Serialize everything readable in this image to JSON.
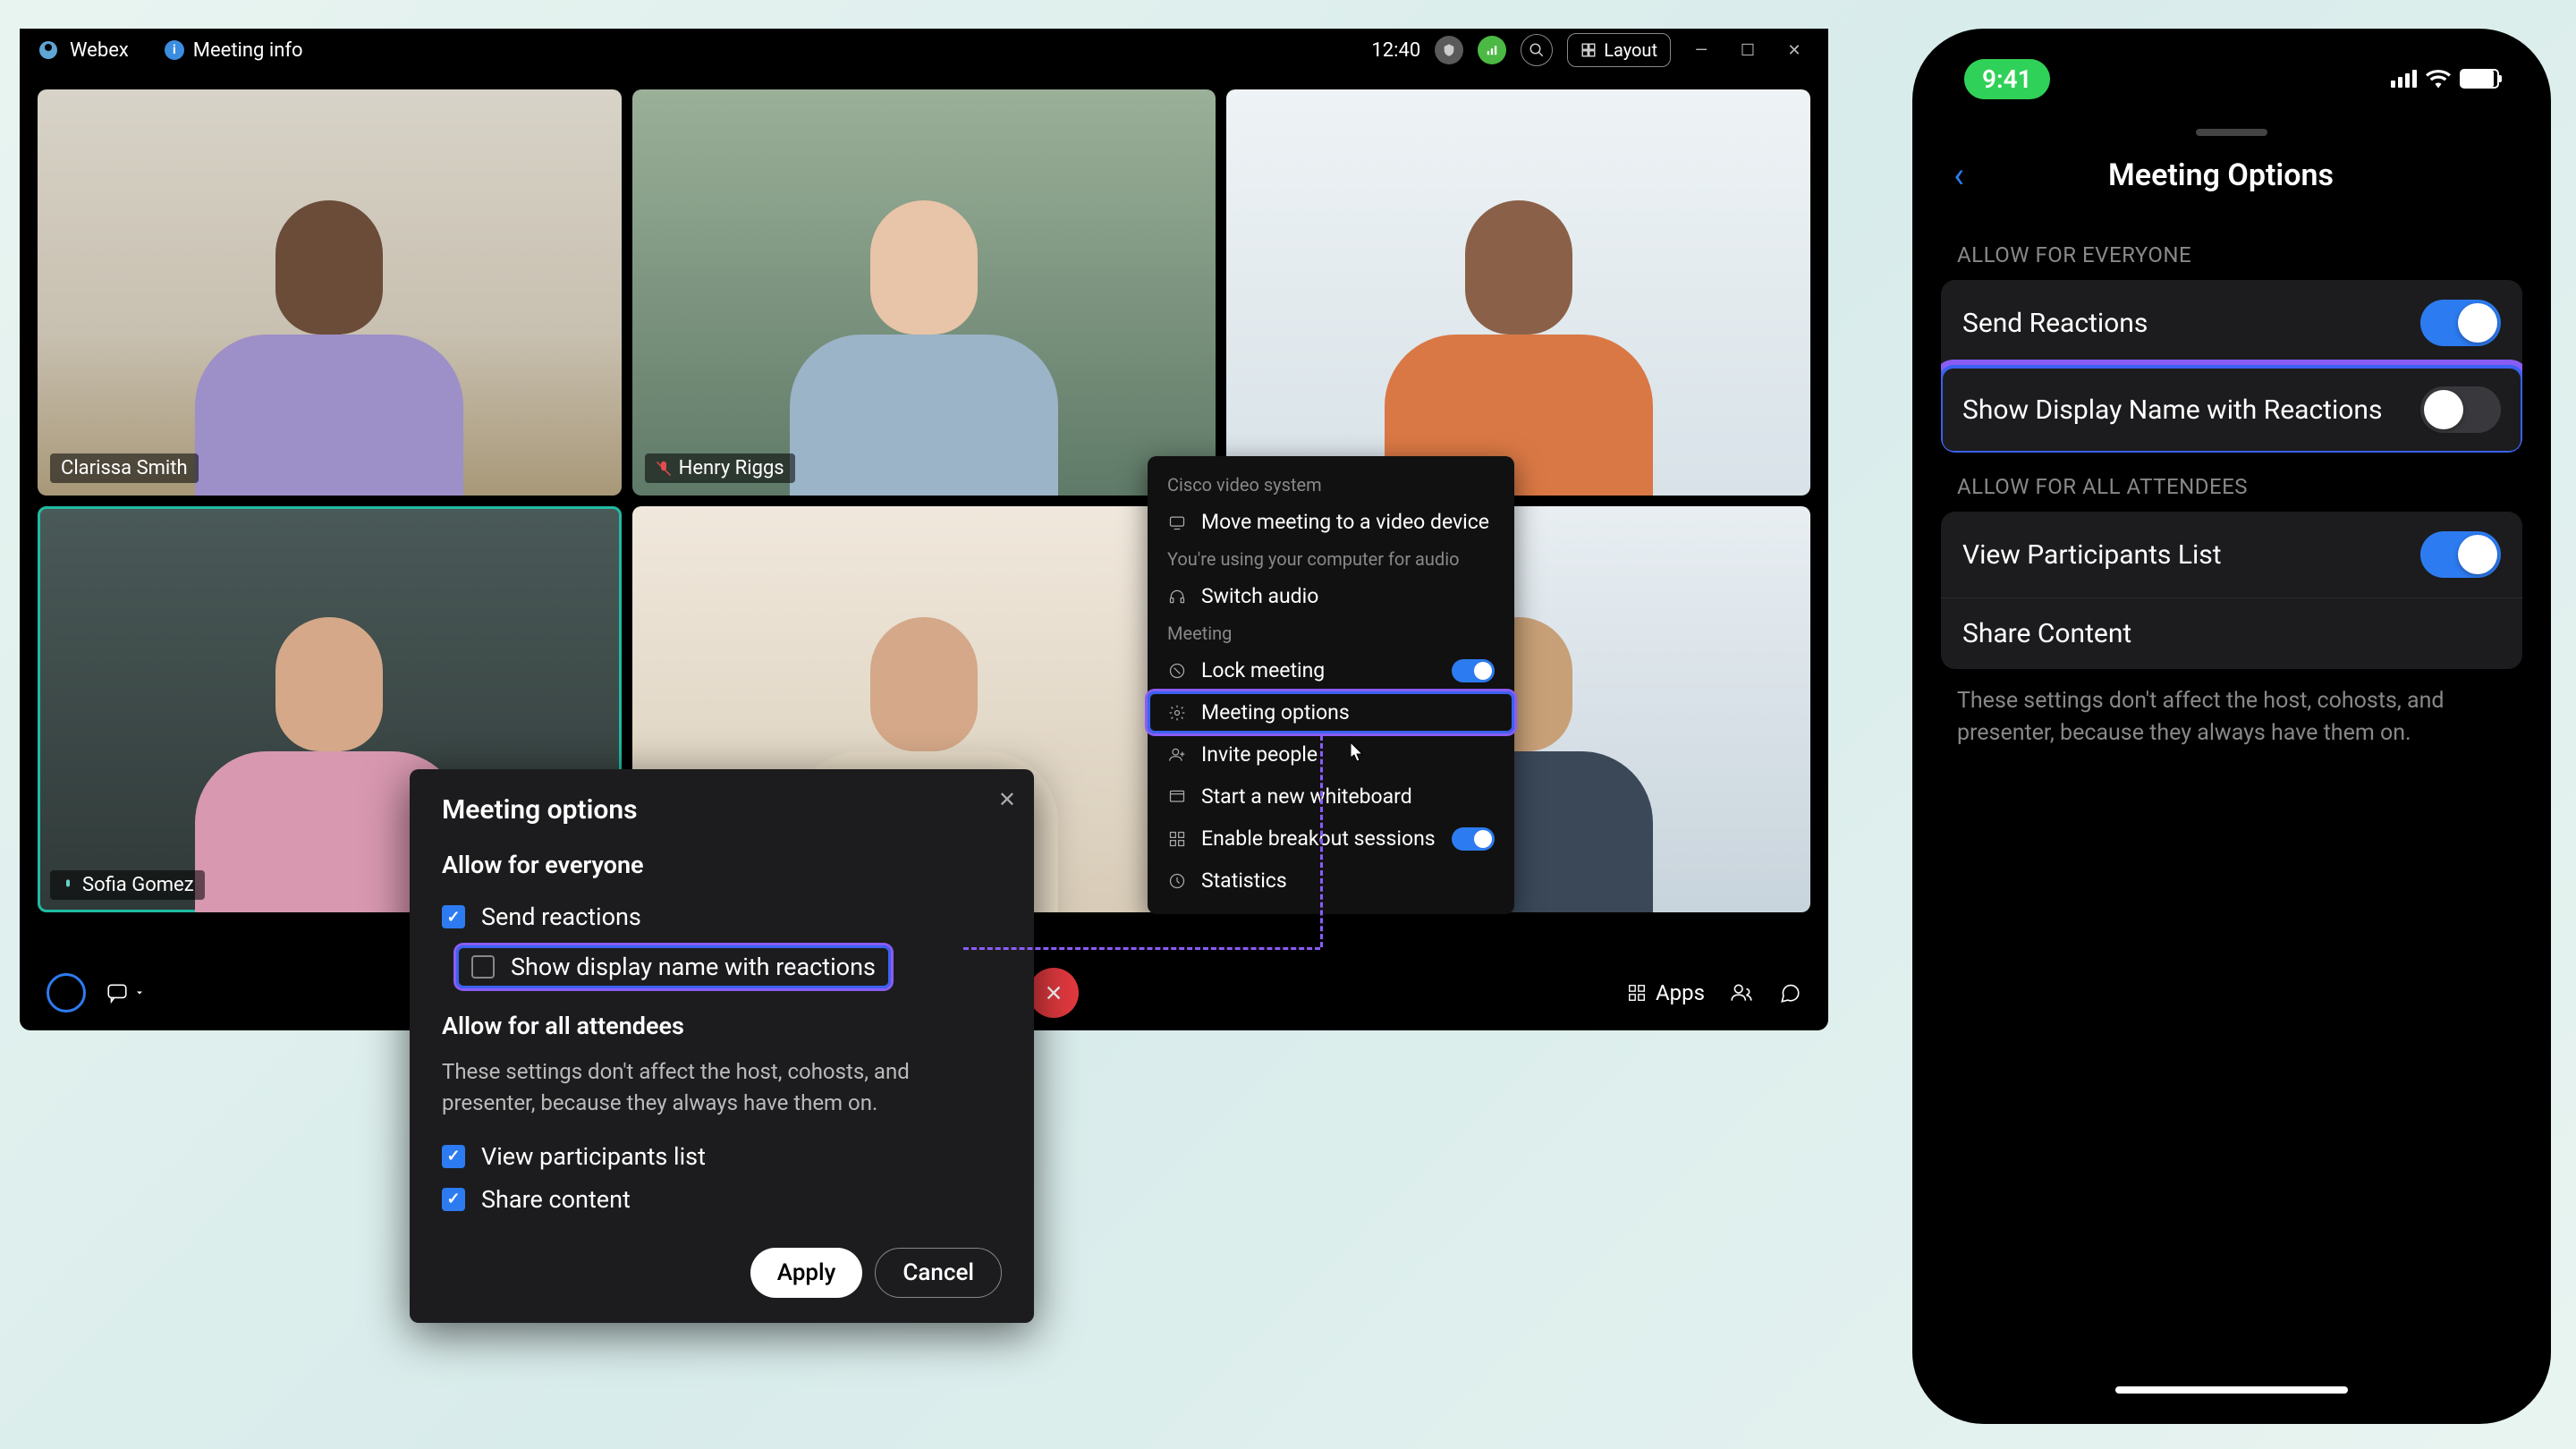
{
  "desktop": {
    "brand": "Webex",
    "meeting_info": "Meeting info",
    "time": "12:40",
    "layout": "Layout",
    "participants": [
      {
        "name": "Clarissa Smith",
        "muted": false
      },
      {
        "name": "Henry Riggs",
        "muted": true
      },
      {
        "name": "",
        "muted": false
      },
      {
        "name": "Sofia Gomez",
        "active": true,
        "muted": false
      },
      {
        "name": "",
        "muted": false
      },
      {
        "name": "",
        "muted": false
      }
    ],
    "toolbar": {
      "record": "Record",
      "apps": "Apps"
    }
  },
  "context_menu": {
    "section1": "Cisco video system",
    "move_device": "Move meeting to a video device",
    "audio_note": "You're using your computer for audio",
    "switch_audio": "Switch audio",
    "section2": "Meeting",
    "lock_meeting": "Lock meeting",
    "lock_on": true,
    "meeting_options": "Meeting options",
    "invite": "Invite people",
    "whiteboard": "Start a new whiteboard",
    "breakout": "Enable breakout sessions",
    "breakout_on": true,
    "statistics": "Statistics"
  },
  "dialog": {
    "title": "Meeting options",
    "section1": "Allow for everyone",
    "send_reactions": "Send reactions",
    "send_reactions_on": true,
    "show_display_name": "Show display name with reactions",
    "show_display_name_on": false,
    "section2": "Allow for all attendees",
    "subtitle": "These settings don't affect the host, cohosts, and presenter, because they always have them on.",
    "view_participants": "View participants list",
    "view_participants_on": true,
    "share_content": "Share content",
    "share_content_on": true,
    "apply": "Apply",
    "cancel": "Cancel"
  },
  "mobile": {
    "status_time": "9:41",
    "title": "Meeting Options",
    "section1": "ALLOW FOR EVERYONE",
    "send_reactions": "Send Reactions",
    "send_reactions_on": true,
    "show_display": "Show Display Name with Reactions",
    "show_display_on": false,
    "section2": "ALLOW FOR ALL ATTENDEES",
    "view_participants": "View Participants List",
    "view_participants_on": true,
    "share_content": "Share Content",
    "share_content_on": true,
    "caption": "These settings don't affect the host, cohosts, and presenter, because they always have them on."
  }
}
